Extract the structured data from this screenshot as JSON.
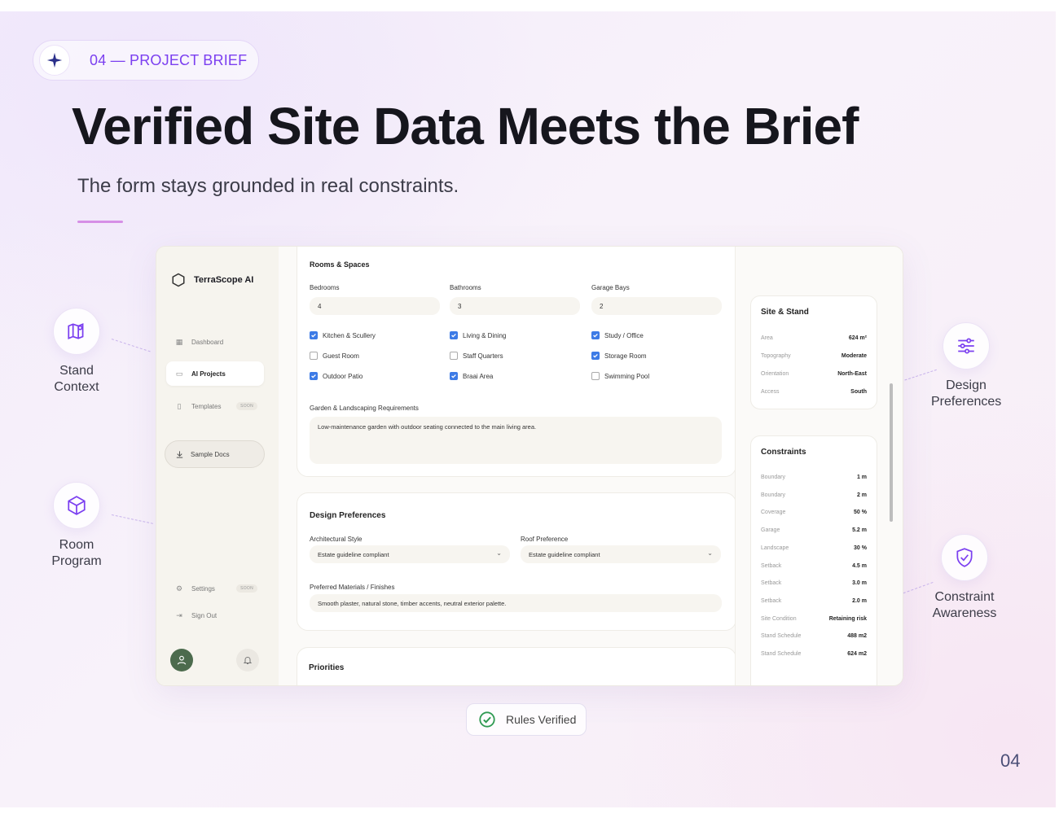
{
  "slide": {
    "tag": "04 — PROJECT BRIEF",
    "title": "Verified Site Data Meets the Brief",
    "subtitle": "The form stays grounded in real constraints.",
    "page_number": "04",
    "verified_badge": "Rules Verified"
  },
  "callouts": {
    "stand_context": "Stand Context",
    "room_program": "Room Program",
    "design_preferences": "Design Preferences",
    "constraint_awareness": "Constraint Awareness"
  },
  "app": {
    "brand": "TerraScope AI",
    "nav": {
      "dashboard": "Dashboard",
      "ai_projects": "AI Projects",
      "templates": "Templates",
      "templates_badge": "SOON",
      "sample_docs": "Sample Docs",
      "settings": "Settings",
      "settings_badge": "SOON",
      "sign_out": "Sign Out"
    },
    "rooms": {
      "title": "Rooms & Spaces",
      "bedrooms_label": "Bedrooms",
      "bedrooms_value": "4",
      "bathrooms_label": "Bathrooms",
      "bathrooms_value": "3",
      "garage_label": "Garage Bays",
      "garage_value": "2",
      "checks": [
        {
          "label": "Kitchen & Scullery",
          "checked": true
        },
        {
          "label": "Living & Dining",
          "checked": true
        },
        {
          "label": "Study / Office",
          "checked": true
        },
        {
          "label": "Guest Room",
          "checked": false
        },
        {
          "label": "Staff Quarters",
          "checked": false
        },
        {
          "label": "Storage Room",
          "checked": true
        },
        {
          "label": "Outdoor Patio",
          "checked": true
        },
        {
          "label": "Braai Area",
          "checked": true
        },
        {
          "label": "Swimming Pool",
          "checked": false
        }
      ],
      "garden_label": "Garden & Landscaping Requirements",
      "garden_value": "Low-maintenance garden with outdoor seating connected to the main living area."
    },
    "design": {
      "title": "Design Preferences",
      "arch_label": "Architectural Style",
      "arch_value": "Estate guideline compliant",
      "roof_label": "Roof Preference",
      "roof_value": "Estate guideline compliant",
      "materials_label": "Preferred Materials / Finishes",
      "materials_value": "Smooth plaster, natural stone, timber accents, neutral exterior palette."
    },
    "priorities": {
      "title": "Priorities"
    },
    "site": {
      "title": "Site & Stand",
      "rows": [
        {
          "k": "Area",
          "v": "624 m²"
        },
        {
          "k": "Topography",
          "v": "Moderate"
        },
        {
          "k": "Orientation",
          "v": "North-East"
        },
        {
          "k": "Access",
          "v": "South"
        }
      ]
    },
    "constraints": {
      "title": "Constraints",
      "rows": [
        {
          "k": "Boundary",
          "v": "1 m"
        },
        {
          "k": "Boundary",
          "v": "2 m"
        },
        {
          "k": "Coverage",
          "v": "50 %"
        },
        {
          "k": "Garage",
          "v": "5.2 m"
        },
        {
          "k": "Landscape",
          "v": "30 %"
        },
        {
          "k": "Setback",
          "v": "4.5 m"
        },
        {
          "k": "Setback",
          "v": "3.0 m"
        },
        {
          "k": "Setback",
          "v": "2.0 m"
        },
        {
          "k": "Site Condition",
          "v": "Retaining risk"
        },
        {
          "k": "Stand Schedule",
          "v": "488 m2"
        },
        {
          "k": "Stand Schedule",
          "v": "624 m2"
        }
      ]
    }
  },
  "colors": {
    "accent": "#7b3ff0",
    "checkbox": "#3d7be6",
    "verified": "#2f9a52"
  }
}
